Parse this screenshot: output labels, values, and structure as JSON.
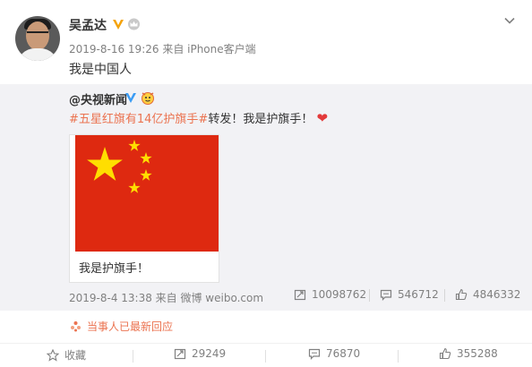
{
  "post": {
    "author": "吴孟达",
    "meta": "2019-8-16 19:26 来自 iPhone客户端",
    "text": "我是中国人"
  },
  "repost": {
    "author": "@央视新闻",
    "hashtag": "#五星红旗有14亿护旗手#",
    "text": "转发！我是护旗手！",
    "card_title": "我是护旗手！",
    "footer_time": "2019-8-4 13:38 来自 微博 weibo.com",
    "stats": {
      "reposts": "10098762",
      "comments": "546712",
      "likes": "4846332"
    }
  },
  "response_note": "当事人已最新回应",
  "actions": {
    "favorite": "收藏",
    "reposts": "29249",
    "comments": "76870",
    "likes": "355288"
  },
  "colors": {
    "accent": "#eb7350",
    "flag_red": "#de2910",
    "flag_yellow": "#ffde00",
    "repost_bg": "#f2f2f5"
  },
  "icons": [
    "chevron-down-icon",
    "verified-v-icon",
    "crown-icon",
    "emoji-badge-icon",
    "heart-icon",
    "repost-icon",
    "comment-icon",
    "like-icon",
    "star-icon",
    "response-icon"
  ]
}
